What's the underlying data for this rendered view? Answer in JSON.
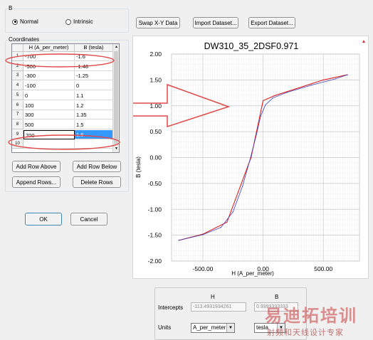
{
  "panel": {
    "group_b_label": "B",
    "coords_label": "Coordinates"
  },
  "mode": {
    "normal": "Normal",
    "intrinsic": "Intrinsic",
    "selected": "normal"
  },
  "toolbar": {
    "swap": "Swap X-Y Data",
    "import": "Import Dataset...",
    "export": "Export Dataset..."
  },
  "table": {
    "headers": [
      "H (A_per_meter)",
      "B (tesla)"
    ],
    "rows": [
      {
        "n": "1",
        "h": "-700",
        "b": "-1.6"
      },
      {
        "n": "2",
        "h": "-500",
        "b": "-1.48"
      },
      {
        "n": "3",
        "h": "-300",
        "b": "-1.25"
      },
      {
        "n": "4",
        "h": "-100",
        "b": "0"
      },
      {
        "n": "5",
        "h": "0",
        "b": "1.1"
      },
      {
        "n": "6",
        "h": "100",
        "b": "1.2"
      },
      {
        "n": "7",
        "h": "300",
        "b": "1.35"
      },
      {
        "n": "8",
        "h": "500",
        "b": "1.5"
      },
      {
        "n": "9",
        "h": "700",
        "b": "1.6"
      },
      {
        "n": "10",
        "h": "",
        "b": ""
      }
    ],
    "selected_row": 8
  },
  "row_buttons": {
    "add_above": "Add Row Above",
    "add_below": "Add Row Below",
    "append": "Append Rows...",
    "delete": "Delete Rows"
  },
  "dialog": {
    "ok": "OK",
    "cancel": "Cancel"
  },
  "bottom": {
    "col_h": "H",
    "col_b": "B",
    "intercepts_label": "Intercepts",
    "intercept_h": "-113.4931934261",
    "intercept_b": "0.9393333333",
    "units_label": "Units",
    "unit_h": "A_per_meter",
    "unit_b": "tesla"
  },
  "watermark": {
    "main": "易迪拓培训",
    "sub": "射频和天线设计专家"
  },
  "colors": {
    "curve": "#dd2222",
    "fit": "#4040c0",
    "annotation": "#e04848"
  },
  "chart_data": {
    "type": "line",
    "title": "DW310_35_2DSF0.971",
    "xlabel": "H (A_per_meter)",
    "ylabel": "B (tesla)",
    "xlim": [
      -760,
      800
    ],
    "ylim": [
      -2.0,
      2.0
    ],
    "xticks": [
      -500,
      0,
      500
    ],
    "xtick_labels": [
      "-500.00",
      "0.00",
      "500.00"
    ],
    "yticks": [
      2.0,
      1.5,
      1.0,
      0.5,
      0.0,
      -0.5,
      -1.0,
      -1.5,
      -2.0
    ],
    "ytick_labels": [
      "2.00",
      "1.50",
      "1.00",
      "0.50",
      "0.00",
      "-0.50",
      "-1.00",
      "-1.50",
      "-2.00"
    ],
    "grid": true,
    "series": [
      {
        "x": [
          -700,
          -500,
          -300,
          -100,
          0,
          100,
          300,
          500,
          700
        ],
        "y": [
          -1.6,
          -1.48,
          -1.25,
          0,
          1.1,
          1.2,
          1.35,
          1.5,
          1.6
        ]
      },
      {
        "x": [
          -700,
          -500,
          -350,
          -250,
          -170,
          -110,
          -60,
          -20,
          20,
          80,
          200,
          400,
          600,
          700
        ],
        "y": [
          -1.6,
          -1.49,
          -1.35,
          -1.05,
          -0.55,
          -0.05,
          0.4,
          0.8,
          1.02,
          1.15,
          1.26,
          1.4,
          1.52,
          1.6
        ]
      }
    ]
  }
}
